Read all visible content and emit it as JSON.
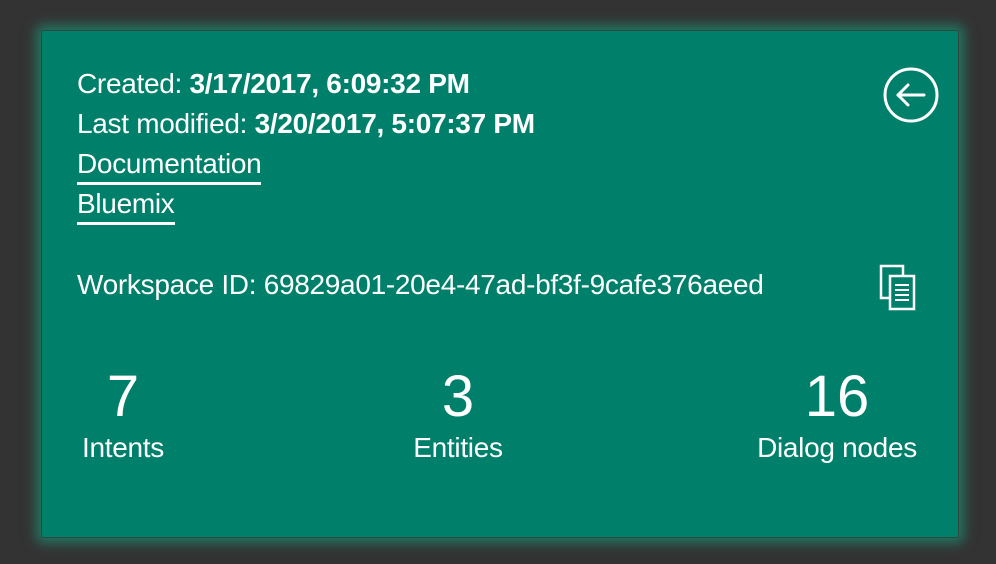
{
  "workspace": {
    "created_label": "Created:",
    "created_value": "3/17/2017, 6:09:32 PM",
    "modified_label": "Last modified:",
    "modified_value": "3/20/2017, 5:07:37 PM",
    "links": {
      "documentation": "Documentation",
      "bluemix": "Bluemix"
    },
    "id_label": "Workspace ID:",
    "id_value": "69829a01-20e4-47ad-bf3f-9cafe376aeed"
  },
  "stats": {
    "intents": {
      "count": "7",
      "label": "Intents"
    },
    "entities": {
      "count": "3",
      "label": "Entities"
    },
    "dialog_nodes": {
      "count": "16",
      "label": "Dialog nodes"
    }
  },
  "icons": {
    "back": "arrow-left-circle-icon",
    "copy": "copy-icon"
  },
  "colors": {
    "background": "#333333",
    "card": "#00806a",
    "glow": "#14be96",
    "text": "#ffffff"
  }
}
